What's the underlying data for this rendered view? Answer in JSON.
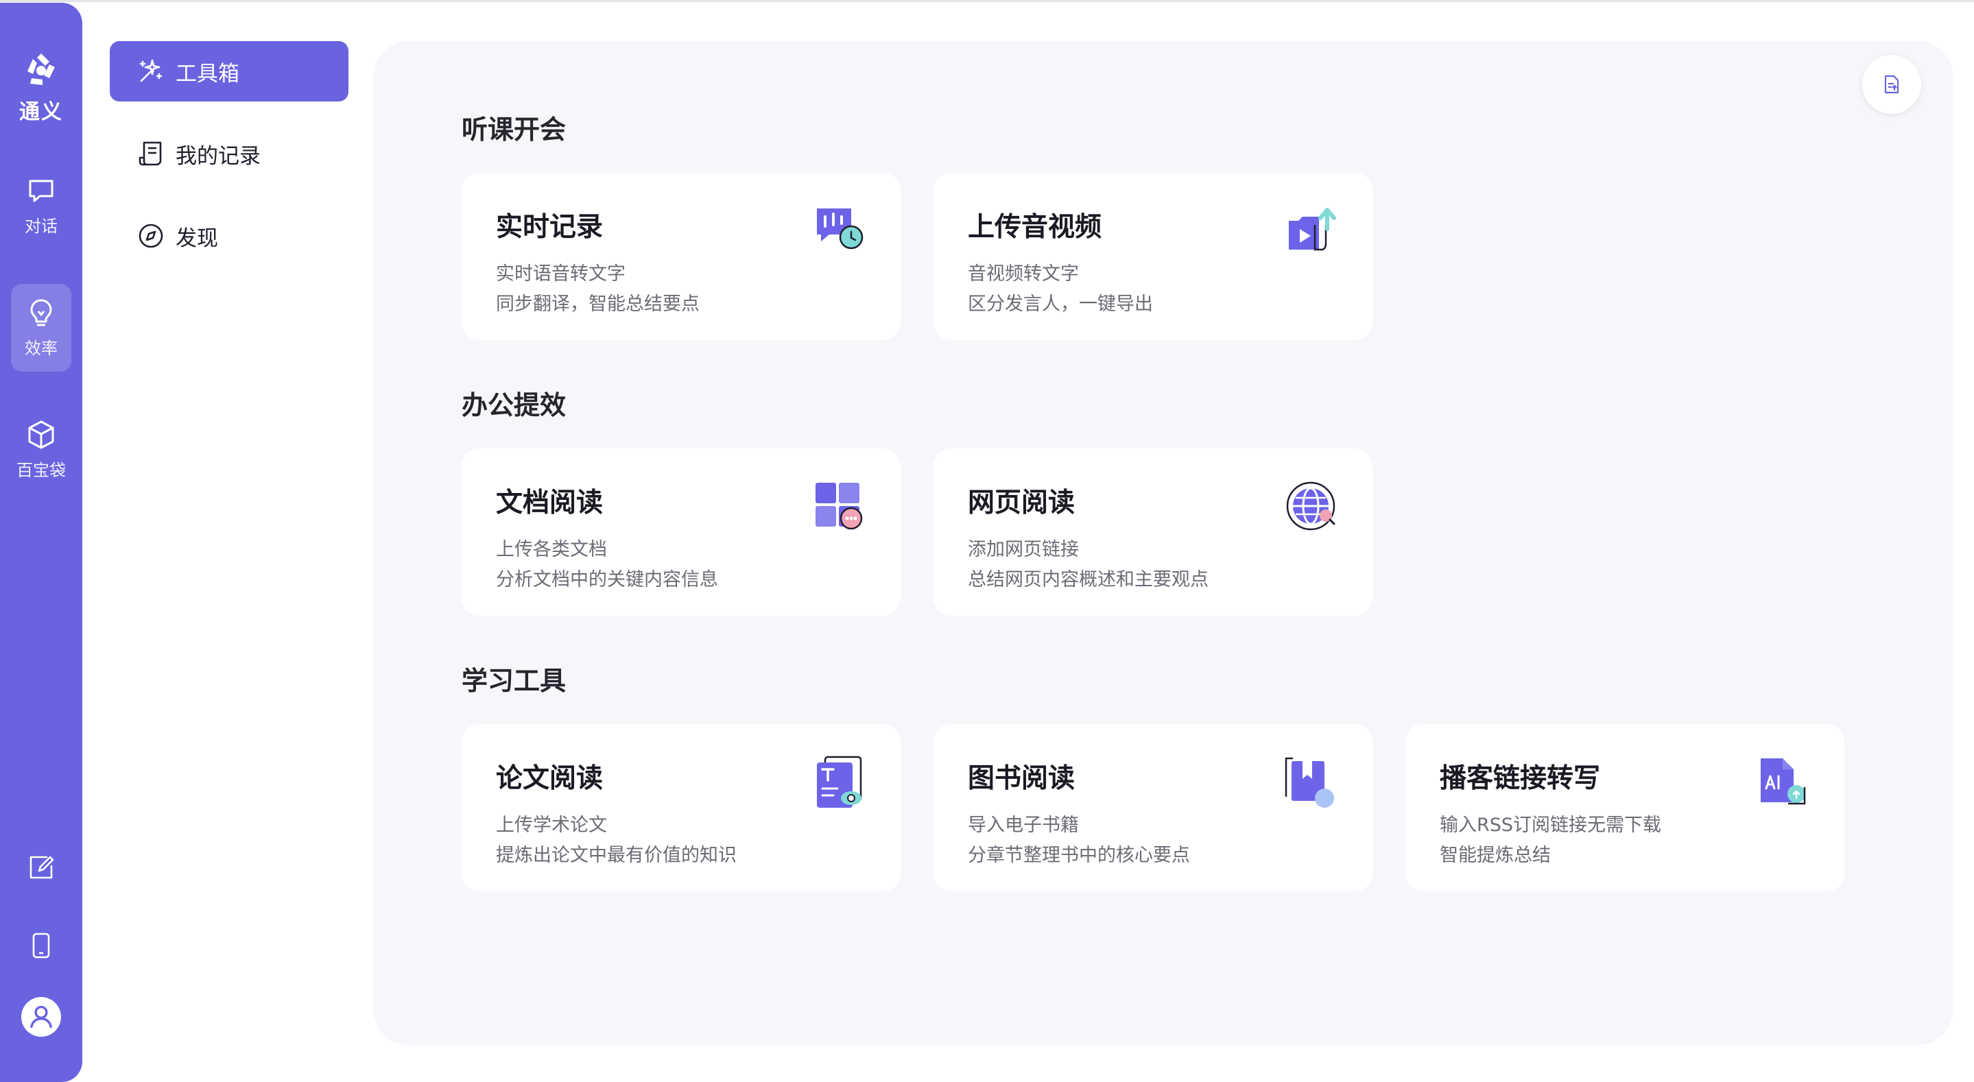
{
  "app": {
    "brand": "通义"
  },
  "rail": {
    "items": [
      {
        "label": "对话",
        "icon": "chat-bubble-icon"
      },
      {
        "label": "效率",
        "icon": "lightbulb-icon",
        "active": true
      },
      {
        "label": "百宝袋",
        "icon": "cube-icon"
      }
    ],
    "bottom_icons": [
      "edit-icon",
      "mobile-icon",
      "user-avatar-icon"
    ]
  },
  "subnav": {
    "items": [
      {
        "label": "工具箱",
        "icon": "magic-wand-icon",
        "active": true
      },
      {
        "label": "我的记录",
        "icon": "record-list-icon"
      },
      {
        "label": "发现",
        "icon": "compass-icon"
      }
    ]
  },
  "sections": [
    {
      "title": "听课开会",
      "cards": [
        {
          "title": "实时记录",
          "lines": [
            "实时语音转文字",
            "同步翻译，智能总结要点"
          ],
          "icon": "realtime-record-icon"
        },
        {
          "title": "上传音视频",
          "lines": [
            "音视频转文字",
            "区分发言人，一键导出"
          ],
          "icon": "upload-video-icon"
        }
      ]
    },
    {
      "title": "办公提效",
      "cards": [
        {
          "title": "文档阅读",
          "lines": [
            "上传各类文档",
            "分析文档中的关键内容信息"
          ],
          "icon": "document-read-icon"
        },
        {
          "title": "网页阅读",
          "lines": [
            "添加网页链接",
            "总结网页内容概述和主要观点"
          ],
          "icon": "web-read-icon"
        }
      ]
    },
    {
      "title": "学习工具",
      "cards": [
        {
          "title": "论文阅读",
          "lines": [
            "上传学术论文",
            "提炼出论文中最有价值的知识"
          ],
          "icon": "paper-read-icon"
        },
        {
          "title": "图书阅读",
          "lines": [
            "导入电子书籍",
            "分章节整理书中的核心要点"
          ],
          "icon": "book-read-icon"
        },
        {
          "title": "播客链接转写",
          "lines": [
            "输入RSS订阅链接无需下载",
            "智能提炼总结"
          ],
          "icon": "podcast-transcribe-icon"
        }
      ]
    }
  ],
  "colors": {
    "accent": "#6963e0",
    "panel": "#f6f7fa",
    "card": "#ffffff"
  }
}
